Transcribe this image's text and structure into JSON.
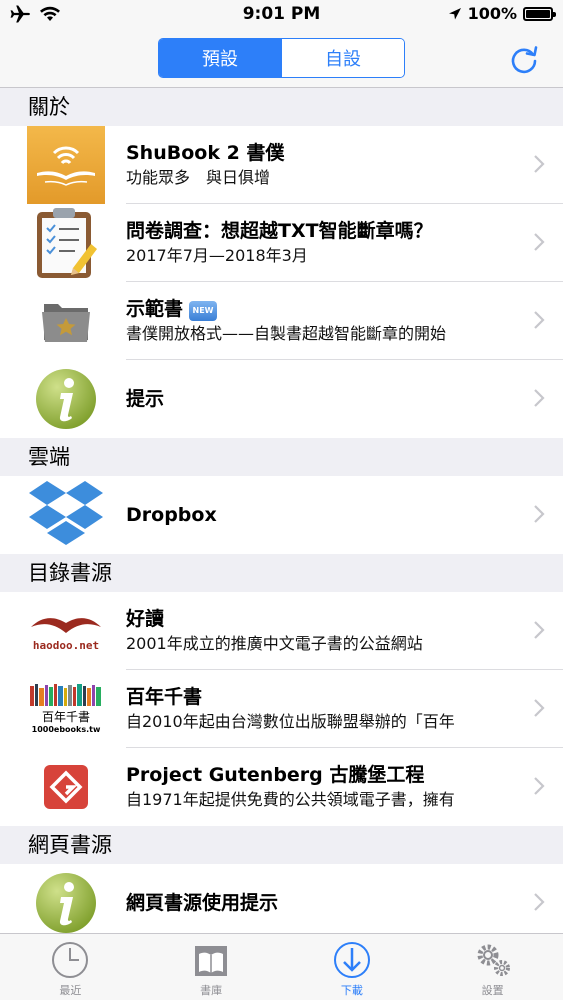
{
  "status_bar": {
    "time": "9:01 PM",
    "battery": "100%"
  },
  "nav": {
    "segments": [
      "預設",
      "自設"
    ],
    "selected_segment": 0
  },
  "sections": [
    {
      "header": "關於",
      "rows": [
        {
          "title": "ShuBook 2 書僕",
          "subtitle": "功能眾多　與日俱增",
          "icon": "shubook-app-icon"
        },
        {
          "title": "問卷調查：想超越TXT智能斷章嗎？",
          "subtitle": "2017年7月—2018年3月",
          "icon": "clipboard-icon"
        },
        {
          "title": "示範書",
          "badge": "NEW",
          "subtitle": "書僕開放格式——自製書超越智能斷章的開始",
          "icon": "folder-star-icon"
        },
        {
          "title": "提示",
          "subtitle": "",
          "icon": "info-icon"
        }
      ]
    },
    {
      "header": "雲端",
      "rows": [
        {
          "title": "Dropbox",
          "subtitle": "",
          "icon": "dropbox-icon"
        }
      ]
    },
    {
      "header": "目錄書源",
      "rows": [
        {
          "title": "好讀",
          "subtitle": "2001年成立的推廣中文電子書的公益網站",
          "icon": "haodoo-logo",
          "logo_text": "haodoo.net"
        },
        {
          "title": "百年千書",
          "subtitle": "自2010年起由台灣數位出版聯盟舉辦的「百年",
          "icon": "1000ebooks-logo",
          "logo_text": "百年千書",
          "logo_subtext": "1000ebooks.tw"
        },
        {
          "title": "Project Gutenberg 古騰堡工程",
          "subtitle": "自1971年起提供免費的公共領域電子書，擁有",
          "icon": "gutenberg-icon"
        }
      ]
    },
    {
      "header": "網頁書源",
      "rows": [
        {
          "title": "網頁書源使用提示",
          "subtitle": "",
          "icon": "info-icon"
        }
      ]
    }
  ],
  "tabbar": {
    "tabs": [
      {
        "label": "最近",
        "icon": "clock-icon"
      },
      {
        "label": "書庫",
        "icon": "book-icon"
      },
      {
        "label": "下載",
        "icon": "download-icon"
      },
      {
        "label": "設置",
        "icon": "gears-icon"
      }
    ],
    "active": 2
  },
  "colors": {
    "accent": "#2d7ff9",
    "background": "#efeff4"
  }
}
